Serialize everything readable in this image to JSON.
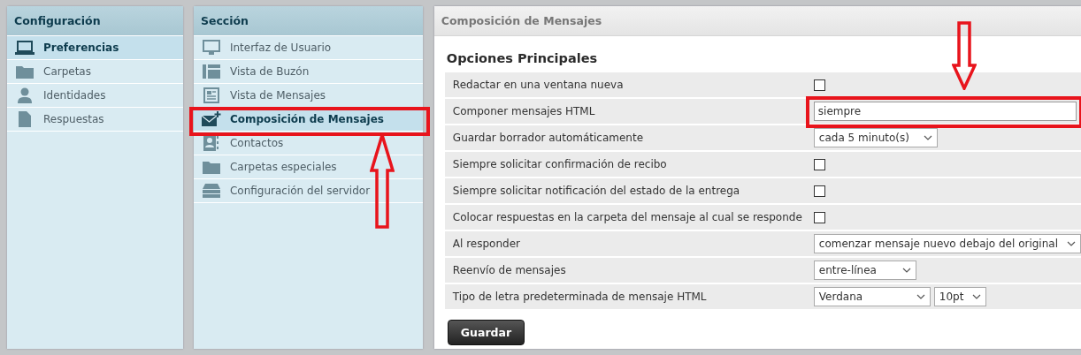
{
  "settings_panel": {
    "title": "Configuración",
    "items": [
      {
        "label": "Preferencias",
        "selected": true
      },
      {
        "label": "Carpetas",
        "selected": false
      },
      {
        "label": "Identidades",
        "selected": false
      },
      {
        "label": "Respuestas",
        "selected": false
      }
    ]
  },
  "section_panel": {
    "title": "Sección",
    "items": [
      {
        "label": "Interfaz de Usuario",
        "selected": false
      },
      {
        "label": "Vista de Buzón",
        "selected": false
      },
      {
        "label": "Vista de Mensajes",
        "selected": false
      },
      {
        "label": "Composición de Mensajes",
        "selected": true
      },
      {
        "label": "Contactos",
        "selected": false
      },
      {
        "label": "Carpetas especiales",
        "selected": false
      },
      {
        "label": "Configuración del servidor",
        "selected": false
      }
    ]
  },
  "content": {
    "title": "Composición de Mensajes",
    "section_heading": "Opciones Principales",
    "options": [
      {
        "label": "Redactar en una ventana nueva",
        "controls": [
          {
            "kind": "checkbox",
            "checked": false
          }
        ]
      },
      {
        "label": "Componer mensajes HTML",
        "controls": [
          {
            "kind": "text",
            "value": "siempre"
          }
        ]
      },
      {
        "label": "Guardar borrador automáticamente",
        "controls": [
          {
            "kind": "select",
            "value": "cada 5 minuto(s)"
          }
        ]
      },
      {
        "label": "Siempre solicitar confirmación de recibo",
        "controls": [
          {
            "kind": "checkbox",
            "checked": false
          }
        ]
      },
      {
        "label": "Siempre solicitar notificación del estado de la entrega",
        "controls": [
          {
            "kind": "checkbox",
            "checked": false
          }
        ]
      },
      {
        "label": "Colocar respuestas en la carpeta del mensaje al cual se responde",
        "controls": [
          {
            "kind": "checkbox",
            "checked": false
          }
        ]
      },
      {
        "label": "Al responder",
        "controls": [
          {
            "kind": "select",
            "value": "comenzar mensaje nuevo debajo del original"
          }
        ]
      },
      {
        "label": "Reenvío de mensajes",
        "controls": [
          {
            "kind": "select",
            "value": "entre-línea"
          }
        ]
      },
      {
        "label": "Tipo de letra predeterminada de mensaje HTML",
        "controls": [
          {
            "kind": "select",
            "value": "Verdana"
          },
          {
            "kind": "select",
            "value": "10pt"
          }
        ]
      }
    ],
    "save_button": "Guardar"
  }
}
